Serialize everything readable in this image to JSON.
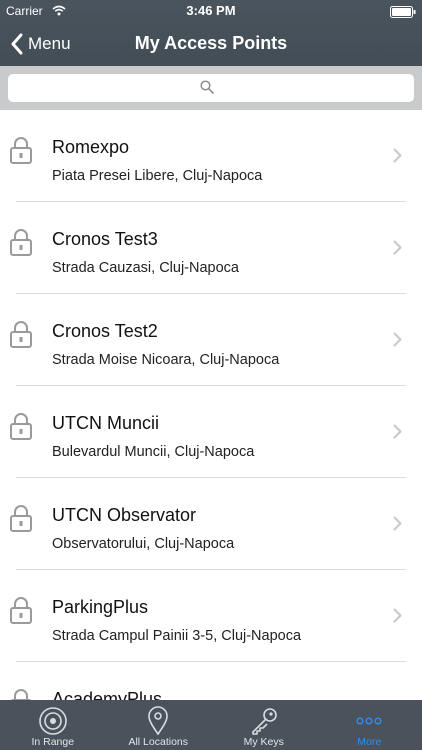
{
  "status_bar": {
    "carrier": "Carrier",
    "time": "3:46 PM"
  },
  "nav": {
    "back_label": "Menu",
    "title": "My Access Points"
  },
  "search": {
    "placeholder": ""
  },
  "access_points": [
    {
      "name": "Romexpo",
      "address": "Piata Presei Libere, Cluj-Napoca"
    },
    {
      "name": "Cronos Test3",
      "address": "Strada Cauzasi, Cluj-Napoca"
    },
    {
      "name": "Cronos Test2",
      "address": "Strada Moise Nicoara, Cluj-Napoca"
    },
    {
      "name": "UTCN Muncii",
      "address": "Bulevardul Muncii, Cluj-Napoca"
    },
    {
      "name": "UTCN Observator",
      "address": "Observatorului, Cluj-Napoca"
    },
    {
      "name": "ParkingPlus",
      "address": "Strada Campul Painii 3-5, Cluj-Napoca"
    },
    {
      "name": "AcademyPlus",
      "address": ""
    }
  ],
  "tabs": [
    {
      "label": "In Range",
      "icon": "target-icon",
      "active": false
    },
    {
      "label": "All Locations",
      "icon": "location-pin-icon",
      "active": false
    },
    {
      "label": "My Keys",
      "icon": "key-icon",
      "active": false
    },
    {
      "label": "More",
      "icon": "more-dots-icon",
      "active": true
    }
  ],
  "colors": {
    "header": "#4a545d",
    "tab_bar": "#4a535b",
    "active_tab": "#2e8ef0",
    "search_background": "#c9cacc"
  }
}
